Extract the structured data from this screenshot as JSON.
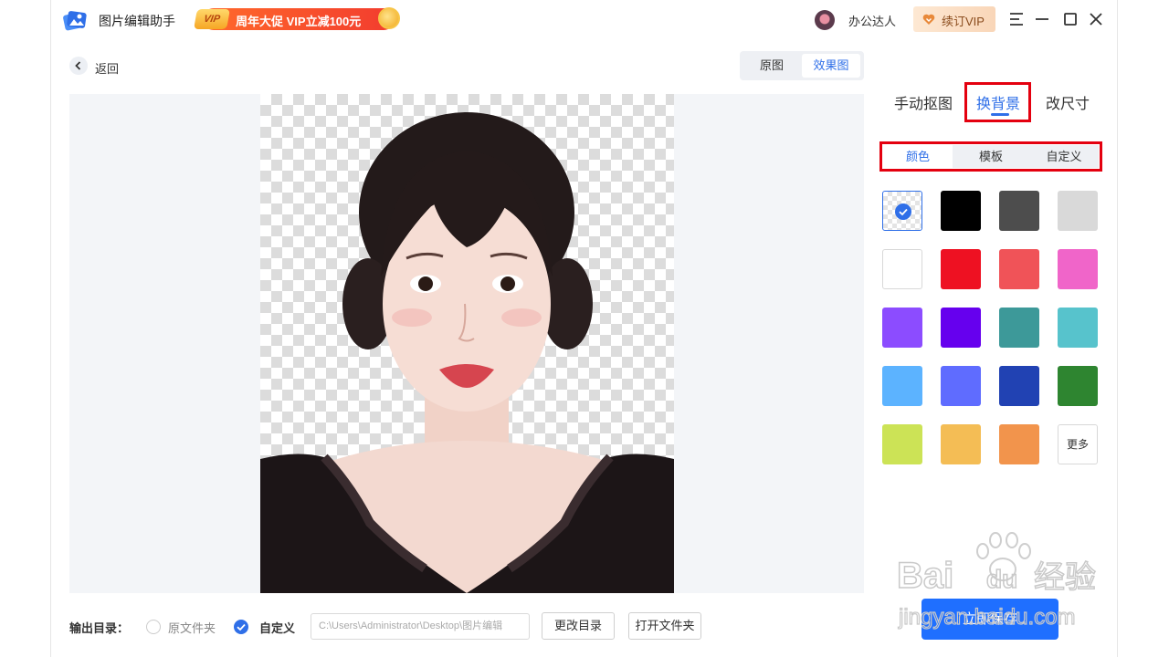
{
  "app": {
    "title": "图片编辑助手",
    "promo_badge": "VIP",
    "promo_text": "周年大促 VIP立减100元",
    "username": "办公达人",
    "renew_vip": "续订VIP"
  },
  "nav": {
    "back_label": "返回"
  },
  "view_toggle": {
    "original": "原图",
    "effect": "效果图"
  },
  "panel": {
    "tabs": [
      "手动抠图",
      "换背景",
      "改尺寸"
    ],
    "active_tab": "换背景",
    "subtabs": [
      "颜色",
      "模板",
      "自定义"
    ],
    "active_subtab": "颜色",
    "swatches": [
      "transparent",
      "#000000",
      "#4d4d4d",
      "#d9d9d9",
      "#ffffff",
      "#ee1122",
      "#f05358",
      "#f065c9",
      "#8c4cff",
      "#6600ee",
      "#3d9999",
      "#57c3cc",
      "#5cb3ff",
      "#5f6cff",
      "#2142b3",
      "#2e8530",
      "#cce356",
      "#f4bd55",
      "#f2944c"
    ],
    "selected_swatch": "transparent",
    "more_label": "更多"
  },
  "output": {
    "label": "输出目录：",
    "option_original": "原文件夹",
    "option_custom": "自定义",
    "selected": "自定义",
    "path": "C:\\Users\\Administrator\\Desktop\\图片编辑",
    "change_dir": "更改目录",
    "open_folder": "打开文件夹",
    "save_now": "立即保存"
  },
  "watermark": {
    "line1": "Bai",
    "line1b": "du",
    "line1c": "经验",
    "line2": "jingyan.baidu.com"
  },
  "colors": {
    "accent": "#2f6fe8",
    "save_button": "#1f6fff",
    "highlight_box": "#e4000f"
  }
}
